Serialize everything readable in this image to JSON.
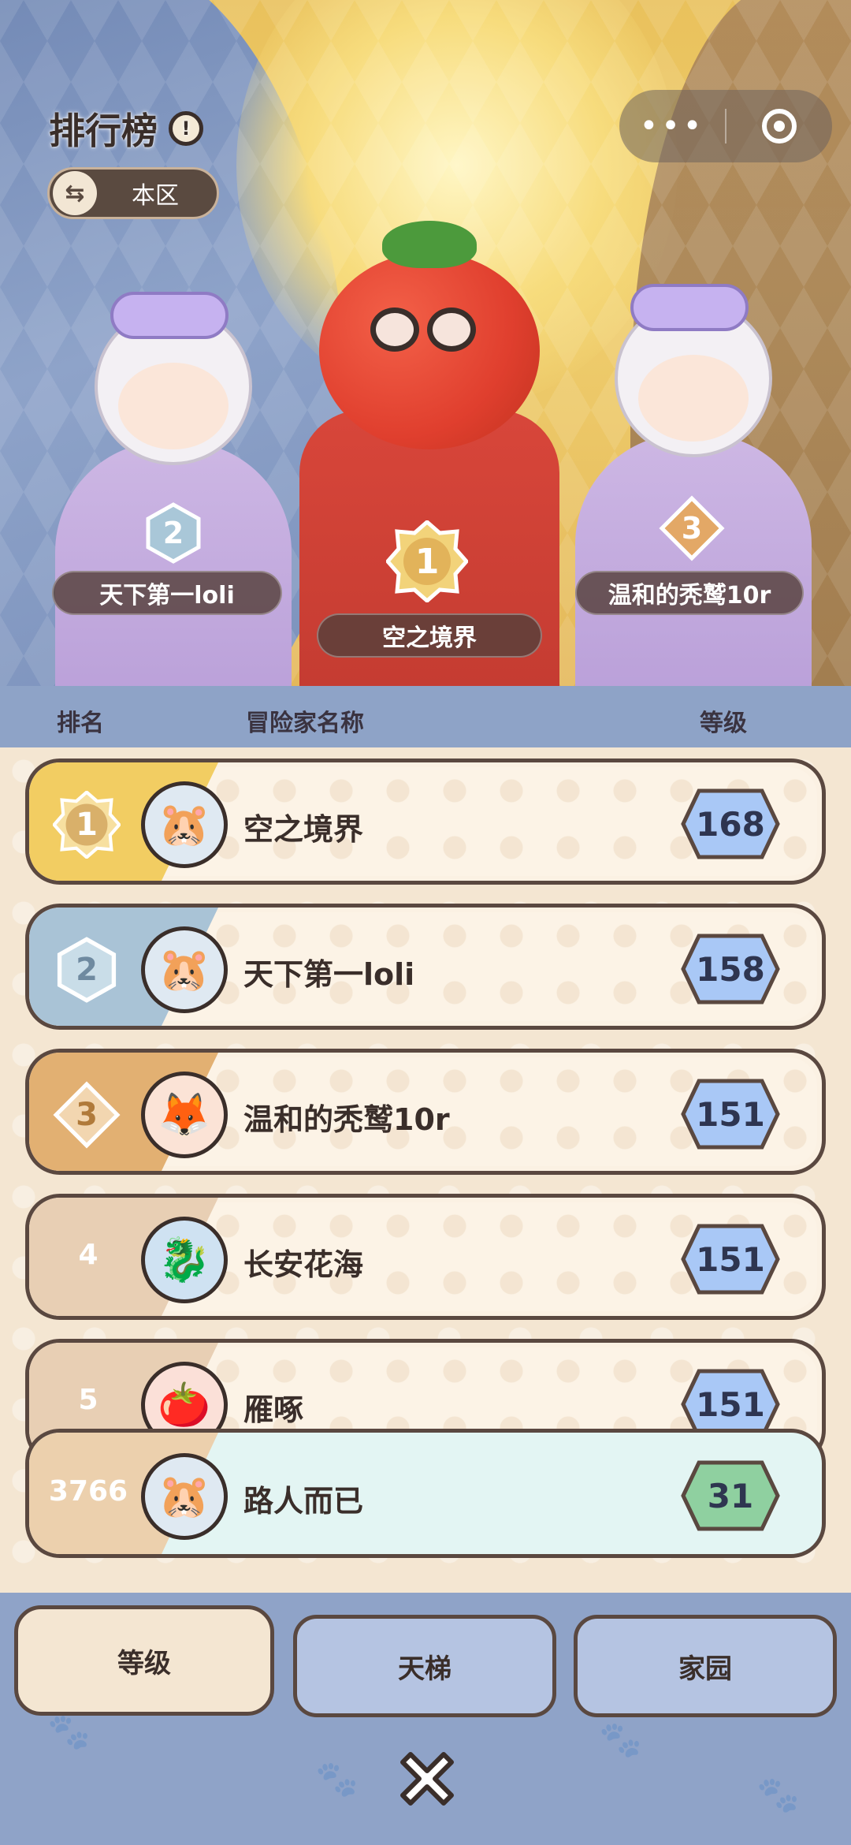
{
  "header": {
    "title": "排行榜",
    "help_icon": "info-icon",
    "region_label": "本区",
    "region_icon": "swap-icon"
  },
  "capsule": {
    "more_icon": "more-dots-icon",
    "close_icon": "target-circle-icon"
  },
  "podium": [
    {
      "rank": "1",
      "name": "空之境界"
    },
    {
      "rank": "2",
      "name": "天下第一loli"
    },
    {
      "rank": "3",
      "name": "温和的秃鹫10r"
    }
  ],
  "columns": {
    "rank": "排名",
    "name": "冒险家名称",
    "level": "等级"
  },
  "rows": [
    {
      "rank": "1",
      "name": "空之境界",
      "level": "168",
      "avatar": "hamster-icon"
    },
    {
      "rank": "2",
      "name": "天下第一loli",
      "level": "158",
      "avatar": "hamster-icon"
    },
    {
      "rank": "3",
      "name": "温和的秃鹫10r",
      "level": "151",
      "avatar": "fox-icon"
    },
    {
      "rank": "4",
      "name": "长安花海",
      "level": "151",
      "avatar": "dragon-icon"
    },
    {
      "rank": "5",
      "name": "雁啄",
      "level": "151",
      "avatar": "tomato-icon"
    }
  ],
  "self": {
    "rank": "3766",
    "name": "路人而已",
    "level": "31",
    "avatar": "hamster-icon"
  },
  "tabs": [
    {
      "label": "等级",
      "active": true
    },
    {
      "label": "天梯",
      "active": false
    },
    {
      "label": "家园",
      "active": false
    }
  ],
  "close_icon": "close-x-icon",
  "colors": {
    "gold": "#f2c85a",
    "silver": "#a9c3d6",
    "bronze": "#e2b072",
    "level_badge": "#a9c8f6",
    "self_badge": "#8fd0a0"
  }
}
